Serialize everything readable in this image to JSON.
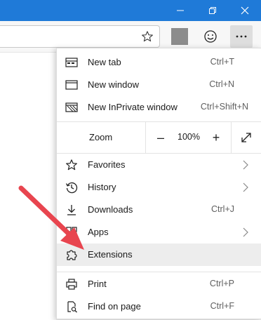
{
  "window": {
    "minimize_icon": "minimize-icon",
    "restore_icon": "restore-icon",
    "close_icon": "close-icon",
    "titlebar_color": "#1f7ad8"
  },
  "toolbar": {
    "favorite_icon": "star-outline-icon",
    "feedback_icon": "smiley-icon",
    "menu_icon": "more-horizontal-icon"
  },
  "menu": {
    "new_tab": {
      "label": "New tab",
      "shortcut": "Ctrl+T"
    },
    "new_window": {
      "label": "New window",
      "shortcut": "Ctrl+N"
    },
    "new_inprivate": {
      "label": "New InPrivate window",
      "shortcut": "Ctrl+Shift+N"
    },
    "zoom": {
      "label": "Zoom",
      "value": "100%",
      "minus": "–",
      "plus": "+"
    },
    "favorites": {
      "label": "Favorites"
    },
    "history": {
      "label": "History"
    },
    "downloads": {
      "label": "Downloads",
      "shortcut": "Ctrl+J"
    },
    "apps": {
      "label": "Apps"
    },
    "extensions": {
      "label": "Extensions"
    },
    "print": {
      "label": "Print",
      "shortcut": "Ctrl+P"
    },
    "find": {
      "label": "Find on page",
      "shortcut": "Ctrl+F"
    }
  },
  "annotation": {
    "arrow_color": "#e8454f"
  }
}
